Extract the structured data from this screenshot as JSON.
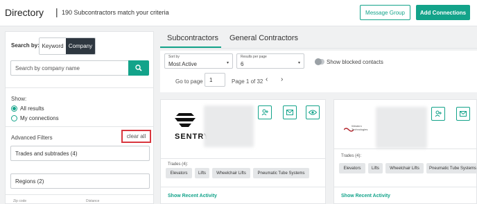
{
  "header": {
    "title": "Directory",
    "separator": "|",
    "result_count": "190 Subcontractors match your criteria",
    "message_group_label": "Message Group",
    "add_connections_label": "Add Connections"
  },
  "sidebar": {
    "search_by_label": "Search by:",
    "modes": [
      "Keyword",
      "Company"
    ],
    "active_mode": "Company",
    "search_placeholder": "Search by company name",
    "show_label": "Show:",
    "show_options": [
      "All results",
      "My connections"
    ],
    "show_selected": "All results",
    "advanced_filters_label": "Advanced Filters",
    "clear_all_label": "clear all",
    "filters": [
      "Trades and subtrades (4)",
      "Regions (2)"
    ],
    "bottom_labels": [
      "Zip code",
      "Distance"
    ]
  },
  "tabs": [
    "Subcontractors",
    "General Contractors"
  ],
  "active_tab": "Subcontractors",
  "controls": {
    "sort_label": "Sort by",
    "sort_value": "Most Active",
    "per_page_label": "Results per page",
    "per_page_value": "6",
    "show_blocked_label": "Show blocked contacts",
    "show_blocked_on": false,
    "go_to_page_label": "Go to page",
    "page_value": "1",
    "page_of": "Page 1 of 32",
    "prev_icon": "‹",
    "next_icon": "›",
    "caret": "▾"
  },
  "cards": [
    {
      "logo_text": "SENTRY",
      "trades_label": "Trades (4):",
      "trades": [
        "Elevators",
        "Lifts",
        "Wheelchair Lifts",
        "Pneumatic Tube Systems"
      ],
      "recent_activity_label": "Show Recent Activity"
    },
    {
      "logo_text": "Western Technologies",
      "trades_label": "Trades (4):",
      "trades": [
        "Elevators",
        "Lifts",
        "Wheelchair Lifts",
        "Pneumatic Tube Systems"
      ],
      "recent_activity_label": "Show Recent Activity"
    }
  ],
  "colors": {
    "accent": "#13a38a",
    "highlight_border": "#d9363e",
    "segment_active": "#2e3740"
  },
  "icons": {
    "search": "search-icon",
    "add_contact": "add-contact-icon",
    "mail": "mail-icon",
    "view": "eye-icon"
  }
}
